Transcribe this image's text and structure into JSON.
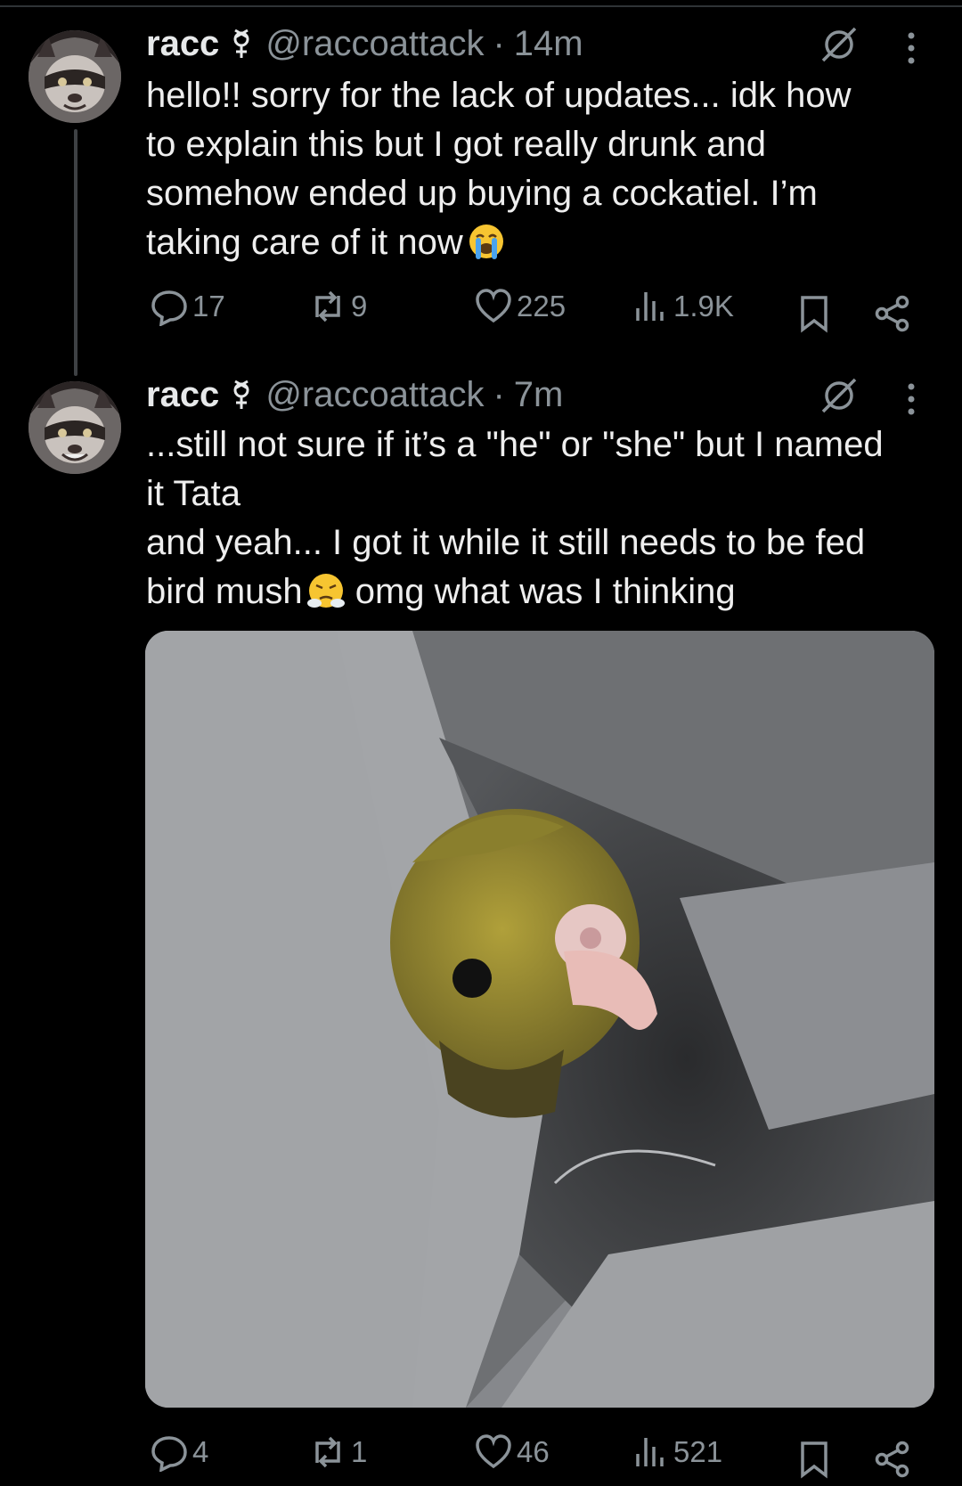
{
  "tweets": [
    {
      "display_name": "racc",
      "pronoun_icon": "nonbinary-symbol-icon",
      "handle": "@raccoattack",
      "separator": "·",
      "time": "14m",
      "text": "hello!! sorry for the lack of updates... idk how\nto explain this but I got really drunk and\nsomehow ended up buying a cockatiel. I’m\ntaking care of it now",
      "emoji": "loudly-crying-face-icon",
      "stats": {
        "replies": "17",
        "reposts": "9",
        "likes": "225",
        "views": "1.9K"
      }
    },
    {
      "display_name": "racc",
      "pronoun_icon": "nonbinary-symbol-icon",
      "handle": "@raccoattack",
      "separator": "·",
      "time": "7m",
      "text_a": "...still not sure if it’s a \"he\" or \"she\" but I named\nit Tata\nand yeah... I got it while it still needs to be fed\nbird mush",
      "emoji": "face-with-steam-from-nose-icon",
      "text_b": " omg what was I thinking",
      "media": "photo of a baby cockatiel tucked in a grey hoodie pocket",
      "stats": {
        "replies": "4",
        "reposts": "1",
        "likes": "46",
        "views": "521"
      }
    }
  ],
  "colors": {
    "background": "#000000",
    "text": "#e7e9ea",
    "muted": "#8b9399",
    "thread_line": "#3e4144"
  }
}
